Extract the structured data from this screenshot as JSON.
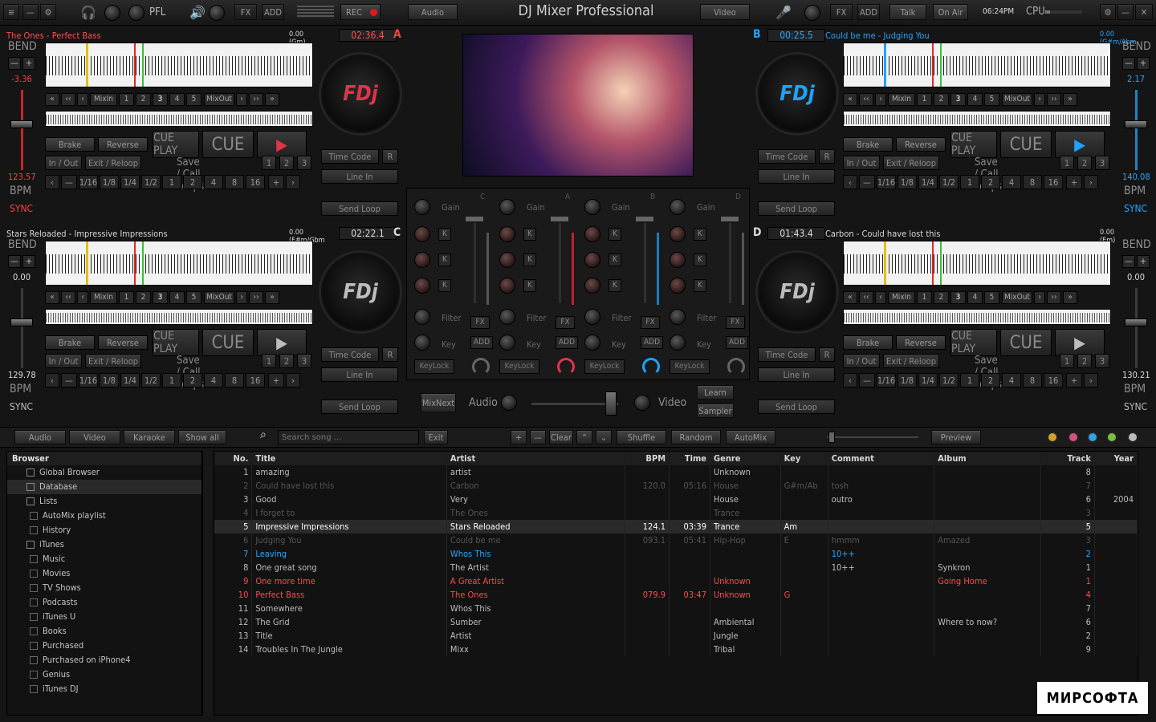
{
  "top": {
    "title": "DJ Mixer Professional",
    "labels": {
      "pfl": "PFL",
      "fx1": "FX",
      "add1": "ADD",
      "rec": "REC",
      "audio": "Audio",
      "video": "Video",
      "fx2": "FX",
      "add2": "ADD",
      "talk": "Talk",
      "onair": "On Air",
      "time": "06:24PM",
      "cpu": "CPU"
    }
  },
  "colors": {
    "accent_blue": "#1ea3ff",
    "accent_red": "#ff3b3b"
  },
  "deckA": {
    "title": "The Ones - Perfect Bass",
    "key": "0.00 (Gm)",
    "time": "02:36.4",
    "letter": "A",
    "pitch": "-3.36",
    "bpm": "123.57"
  },
  "deckB": {
    "title": "Could be me - Judging You",
    "key": "0.00 (G#m/Abm",
    "time": "00:25.5",
    "letter": "B",
    "pitch": "2.17",
    "bpm": "140.08"
  },
  "deckC": {
    "title": "Stars Reloaded - Impressive Impressions",
    "key": "0.00 (F#m/Gbm",
    "time": "02:22.1",
    "letter": "C",
    "pitch": "0.00",
    "bpm": "129.78"
  },
  "deckD": {
    "title": "Carbon - Could have lost this",
    "key": "0.00 (Em)",
    "time": "01:43.4",
    "letter": "D",
    "pitch": "0.00",
    "bpm": "130.21"
  },
  "deck_controls": {
    "bend": "BEND",
    "bpm": "BPM",
    "sync": "SYNC",
    "mixin": "MixIn",
    "mixout": "MixOut",
    "brake": "Brake",
    "reverse": "Reverse",
    "cueplay": "CUE PLAY",
    "cue": "CUE",
    "inout": "In / Out",
    "exitreloop": "Exit / Reloop",
    "saveloops": "Save / Call Loops",
    "timecode": "Time Code",
    "r": "R",
    "linein": "Line In",
    "sendloop": "Send Loop",
    "loop_sizes": [
      "1/16",
      "1/8",
      "1/4",
      "1/2",
      "1",
      "2",
      "4",
      "8",
      "16"
    ],
    "nums": [
      "1",
      "2",
      "3",
      "4",
      "5"
    ],
    "loop123": [
      "1",
      "2",
      "3"
    ]
  },
  "mixer": {
    "gain": "Gain",
    "k": "K",
    "filter": "Filter",
    "key": "Key",
    "fx": "FX",
    "add": "ADD",
    "keylock": "KeyLock",
    "channels": [
      "C",
      "A",
      "B",
      "D"
    ],
    "mixnext": "MixNext",
    "audio": "Audio",
    "video": "Video",
    "learn": "Learn",
    "sampler": "Sampler"
  },
  "toolbar": {
    "audio": "Audio",
    "video": "Video",
    "karaoke": "Karaoke",
    "showall": "Show all",
    "search_placeholder": "Search song ...",
    "exit": "Exit",
    "clear": "Clear",
    "shuffle": "Shuffle",
    "random": "Random",
    "automix": "AutoMix",
    "preview": "Preview"
  },
  "browser": {
    "header": "Browser",
    "items": [
      {
        "label": "Global Browser",
        "indent": 1
      },
      {
        "label": "Database",
        "indent": 1
      },
      {
        "label": "Lists",
        "indent": 1
      },
      {
        "label": "AutoMix playlist",
        "indent": 2
      },
      {
        "label": "History",
        "indent": 2
      },
      {
        "label": "iTunes",
        "indent": 1
      },
      {
        "label": "Music",
        "indent": 2
      },
      {
        "label": "Movies",
        "indent": 2
      },
      {
        "label": "TV Shows",
        "indent": 2
      },
      {
        "label": "Podcasts",
        "indent": 2
      },
      {
        "label": "iTunes U",
        "indent": 2
      },
      {
        "label": "Books",
        "indent": 2
      },
      {
        "label": "Purchased",
        "indent": 2
      },
      {
        "label": "Purchased on iPhone4",
        "indent": 2
      },
      {
        "label": "Genius",
        "indent": 2
      },
      {
        "label": "iTunes DJ",
        "indent": 2
      }
    ]
  },
  "tracks": {
    "headers": [
      "No.",
      "Title",
      "Artist",
      "BPM",
      "Time",
      "Genre",
      "Key",
      "Comment",
      "Album",
      "Track",
      "Year"
    ],
    "rows": [
      {
        "no": "1",
        "title": "amazing",
        "artist": "artist",
        "bpm": "",
        "time": "",
        "genre": "Unknown",
        "key": "",
        "comment": "",
        "album": "",
        "track": "8",
        "year": "",
        "style": ""
      },
      {
        "no": "2",
        "title": "Could have lost this",
        "artist": "Carbon",
        "bpm": "120.0",
        "time": "05:16",
        "genre": "House",
        "key": "G#m/Ab",
        "comment": "tosh",
        "album": "",
        "track": "7",
        "year": "",
        "style": "dim"
      },
      {
        "no": "3",
        "title": "Good",
        "artist": "Very",
        "bpm": "",
        "time": "",
        "genre": "House",
        "key": "",
        "comment": "outro",
        "album": "",
        "track": "6",
        "year": "2004",
        "style": ""
      },
      {
        "no": "4",
        "title": "I forget to",
        "artist": "The Ones",
        "bpm": "",
        "time": "",
        "genre": "Trance",
        "key": "",
        "comment": "",
        "album": "",
        "track": "3",
        "year": "",
        "style": "dim"
      },
      {
        "no": "5",
        "title": "Impressive Impressions",
        "artist": "Stars Reloaded",
        "bpm": "124.1",
        "time": "03:39",
        "genre": "Trance",
        "key": "Am",
        "comment": "",
        "album": "",
        "track": "5",
        "year": "",
        "style": "sel"
      },
      {
        "no": "6",
        "title": "Judging You",
        "artist": "Could be me",
        "bpm": "093.1",
        "time": "05:41",
        "genre": "Hip-Hop",
        "key": "E",
        "comment": "hmmm",
        "album": "Amazed",
        "track": "3",
        "year": "",
        "style": "dim"
      },
      {
        "no": "7",
        "title": "Leaving",
        "artist": "Whos This",
        "bpm": "",
        "time": "",
        "genre": "",
        "key": "",
        "comment": "10++",
        "album": "",
        "track": "2",
        "year": "",
        "style": "blue"
      },
      {
        "no": "8",
        "title": "One great song",
        "artist": "The Artist",
        "bpm": "",
        "time": "",
        "genre": "",
        "key": "",
        "comment": "10++",
        "album": "Synkron",
        "track": "1",
        "year": "",
        "style": ""
      },
      {
        "no": "9",
        "title": "One more time",
        "artist": "A Great Artist",
        "bpm": "",
        "time": "",
        "genre": "Unknown",
        "key": "",
        "comment": "",
        "album": "Going Home",
        "track": "1",
        "year": "",
        "style": "red"
      },
      {
        "no": "10",
        "title": "Perfect Bass",
        "artist": "The Ones",
        "bpm": "079.9",
        "time": "03:47",
        "genre": "Unknown",
        "key": "G",
        "comment": "",
        "album": "",
        "track": "4",
        "year": "",
        "style": "red"
      },
      {
        "no": "11",
        "title": "Somewhere",
        "artist": "Whos This",
        "bpm": "",
        "time": "",
        "genre": "",
        "key": "",
        "comment": "",
        "album": "",
        "track": "7",
        "year": "",
        "style": ""
      },
      {
        "no": "12",
        "title": "The Grid",
        "artist": "Sumber",
        "bpm": "",
        "time": "",
        "genre": "Ambiental",
        "key": "",
        "comment": "",
        "album": "Where to now?",
        "track": "6",
        "year": "",
        "style": ""
      },
      {
        "no": "13",
        "title": "Title",
        "artist": "Artist",
        "bpm": "",
        "time": "",
        "genre": "Jungle",
        "key": "",
        "comment": "",
        "album": "",
        "track": "2",
        "year": "",
        "style": ""
      },
      {
        "no": "14",
        "title": "Troubles In The Jungle",
        "artist": "Mixx",
        "bpm": "",
        "time": "",
        "genre": "Tribal",
        "key": "",
        "comment": "",
        "album": "",
        "track": "9",
        "year": "",
        "style": ""
      }
    ]
  },
  "watermark": "МИРСОФТА"
}
